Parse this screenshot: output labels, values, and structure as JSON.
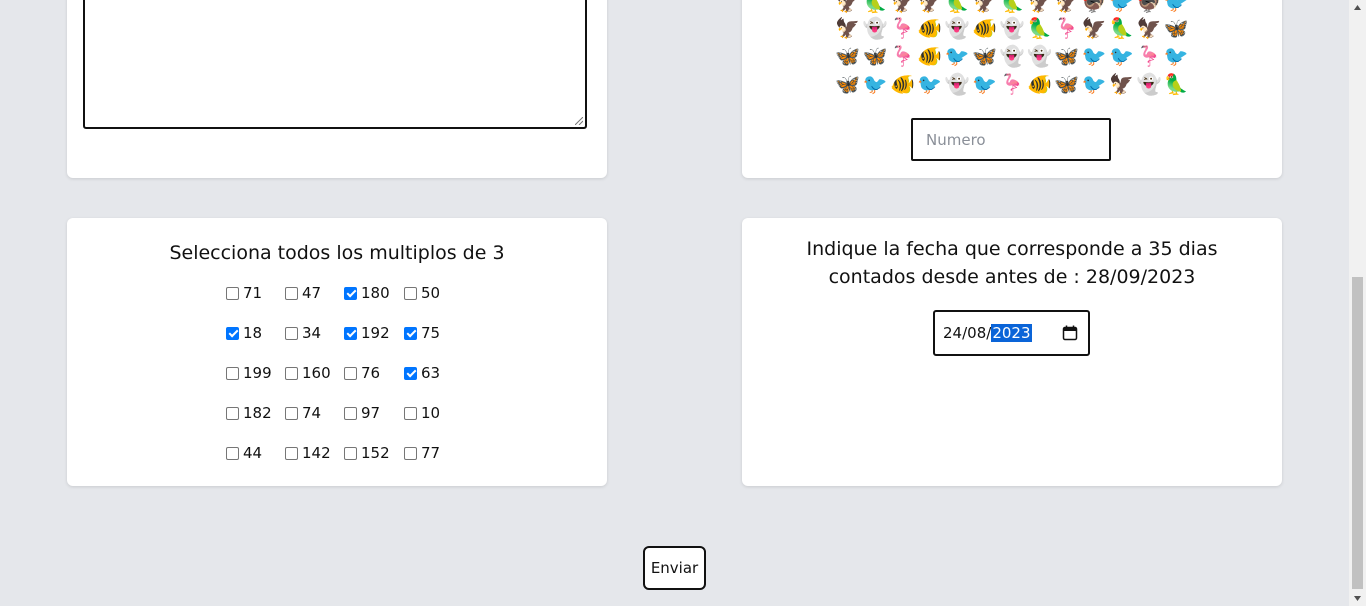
{
  "emoji_grid": {
    "rows": [
      [
        "🦅",
        "🦜",
        "🦅",
        "🦅",
        "🦜",
        "🦅",
        "🦜",
        "🦅",
        "🦅",
        "🦃",
        "🐦",
        "🦃",
        "🐦"
      ],
      [
        "🦅",
        "👻",
        "🦩",
        "🐠",
        "👻",
        "🐠",
        "👻",
        "🦜",
        "🦩",
        "🦅",
        "🦜",
        "🦅",
        "🦋"
      ],
      [
        "🦋",
        "🦋",
        "🦩",
        "🐠",
        "🐦",
        "🦋",
        "👻",
        "👻",
        "🦋",
        "🐦",
        "🐦",
        "🦩",
        "🐦"
      ],
      [
        "🦋",
        "🐦",
        "🐠",
        "🐦",
        "👻",
        "🐦",
        "🦩",
        "🐠",
        "🦋",
        "🐦",
        "🦅",
        "👻",
        "🦜"
      ]
    ]
  },
  "numero_input": {
    "placeholder": "Numero",
    "value": ""
  },
  "multiples": {
    "title": "Selecciona todos los multiplos de 3",
    "options": [
      {
        "label": "71",
        "checked": false
      },
      {
        "label": "47",
        "checked": false
      },
      {
        "label": "180",
        "checked": true
      },
      {
        "label": "50",
        "checked": false
      },
      {
        "label": "18",
        "checked": true
      },
      {
        "label": "34",
        "checked": false
      },
      {
        "label": "192",
        "checked": true
      },
      {
        "label": "75",
        "checked": true
      },
      {
        "label": "199",
        "checked": false
      },
      {
        "label": "160",
        "checked": false
      },
      {
        "label": "76",
        "checked": false
      },
      {
        "label": "63",
        "checked": true
      },
      {
        "label": "182",
        "checked": false
      },
      {
        "label": "74",
        "checked": false
      },
      {
        "label": "97",
        "checked": false
      },
      {
        "label": "10",
        "checked": false
      },
      {
        "label": "44",
        "checked": false
      },
      {
        "label": "142",
        "checked": false
      },
      {
        "label": "152",
        "checked": false
      },
      {
        "label": "77",
        "checked": false
      }
    ]
  },
  "date_question": {
    "title": "Indique la fecha que corresponde a 35 dias contados desde antes de : 28/09/2023",
    "day": "24",
    "month": "08",
    "year": "2023",
    "sep1": "/",
    "sep2": "/"
  },
  "submit": {
    "label": "Enviar"
  },
  "colors": {
    "checkbox_checked": "#0075ff",
    "page_bg": "#e5e7eb",
    "selection": "#0a64d8"
  }
}
